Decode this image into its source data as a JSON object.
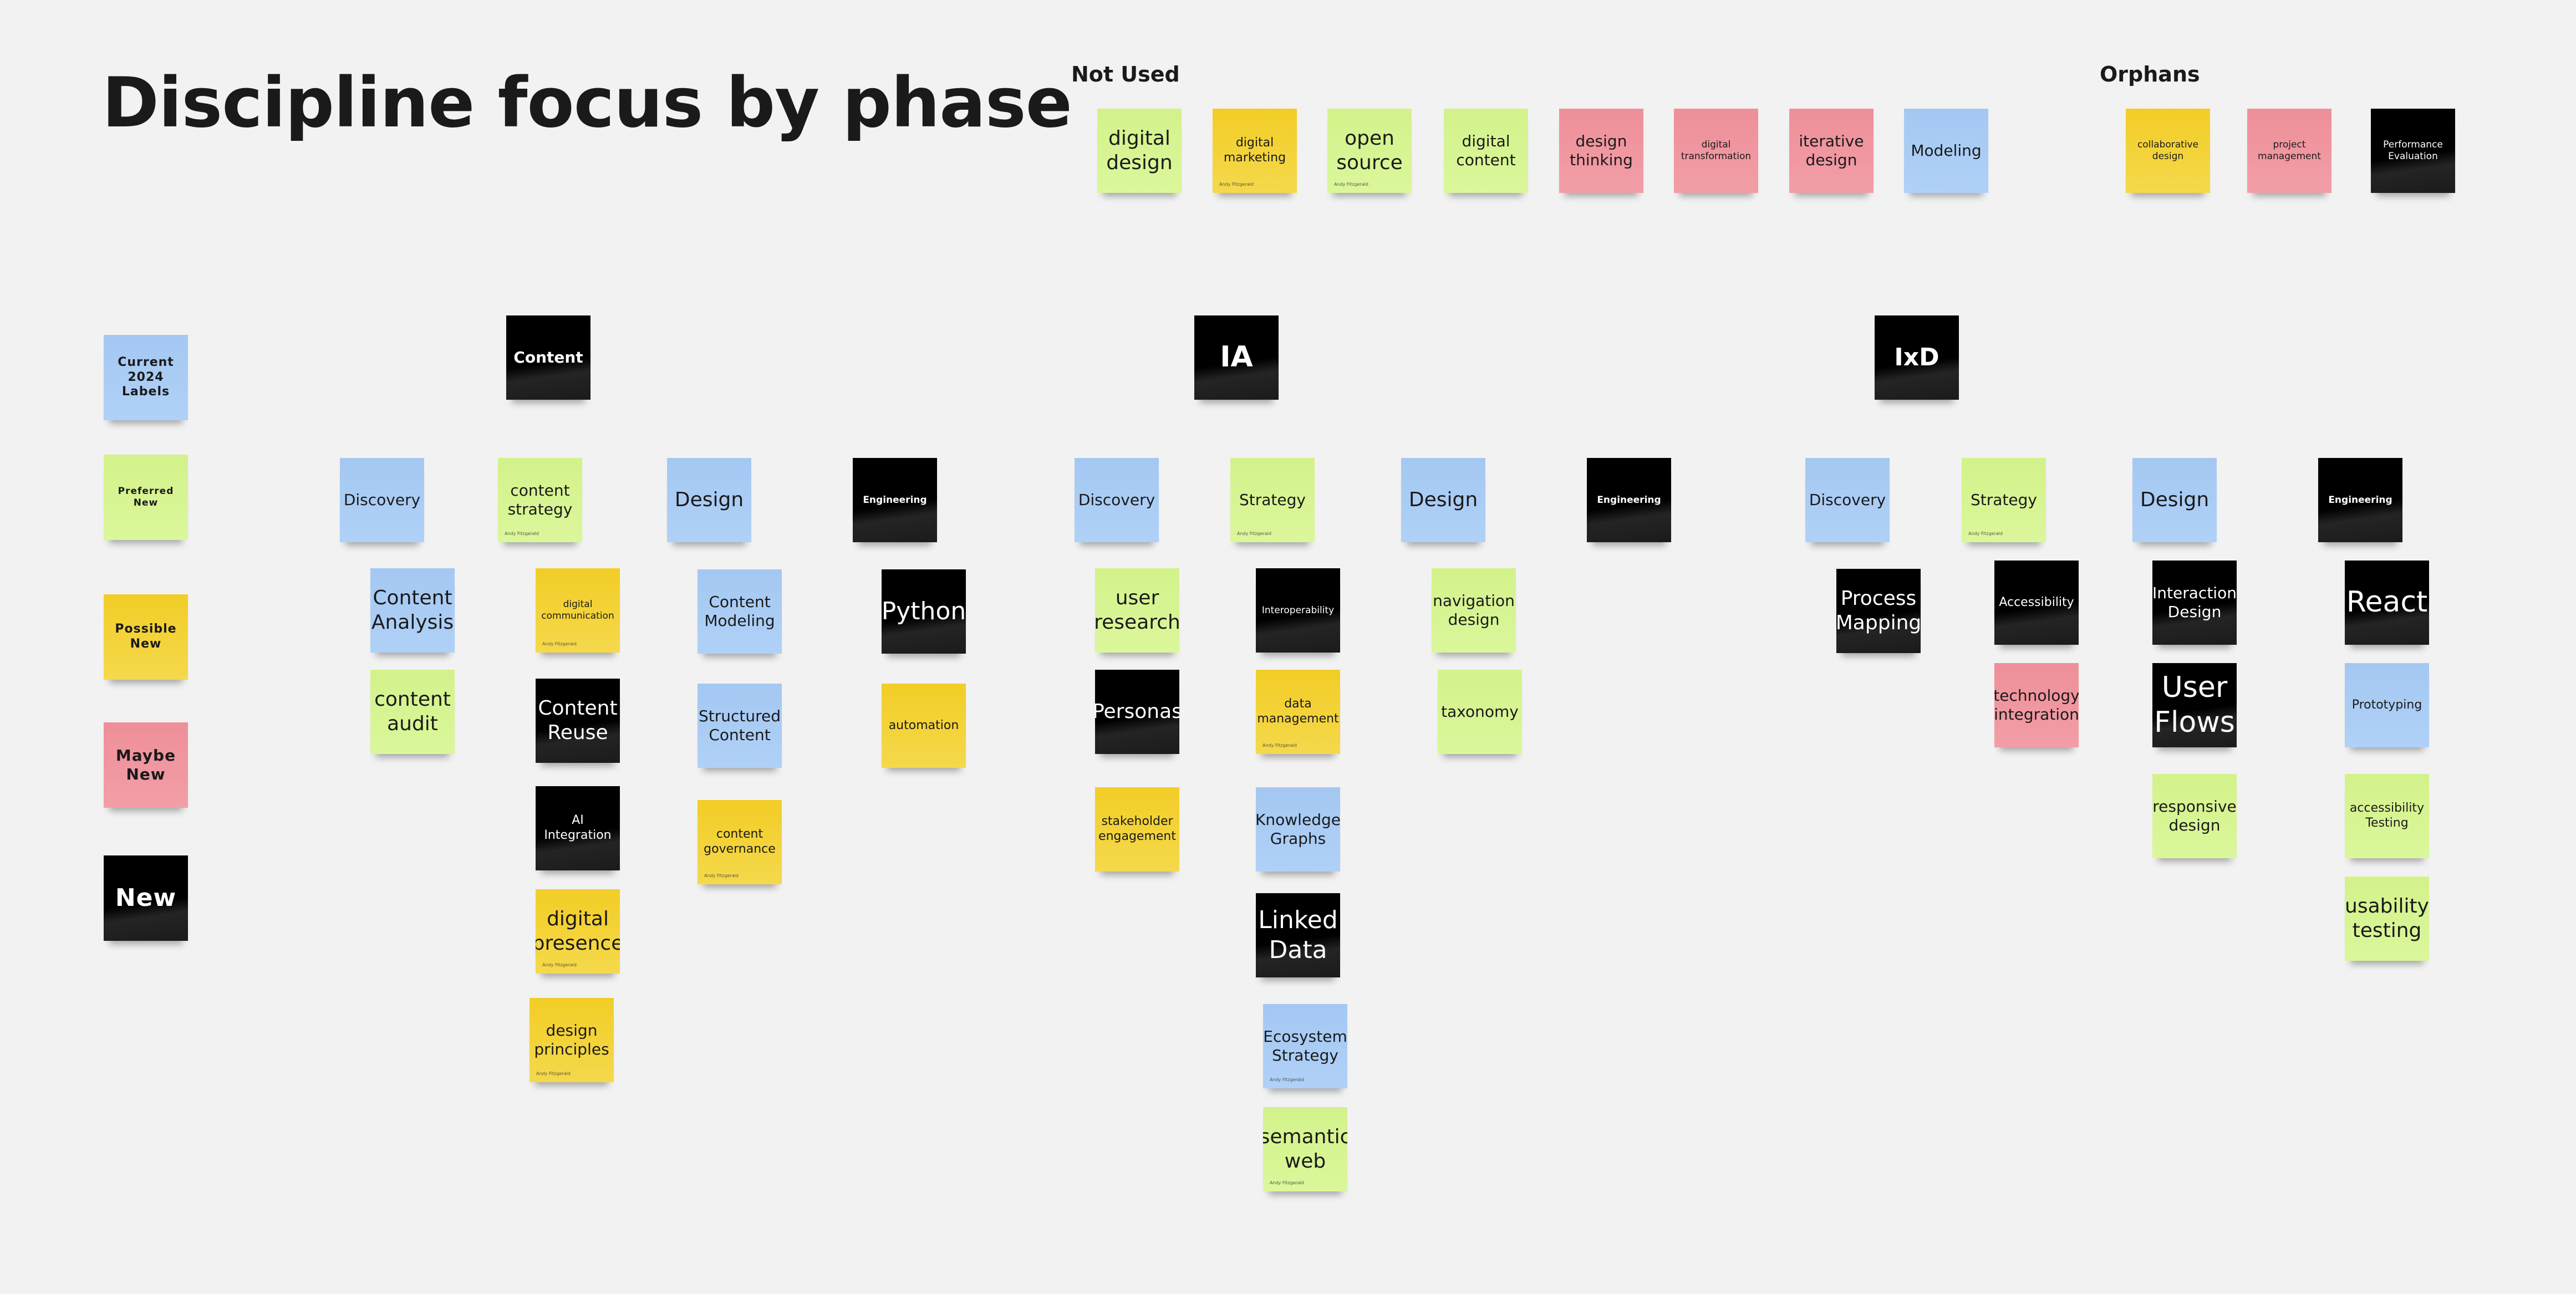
{
  "board": {
    "title": "Discipline focus by phase",
    "colors": {
      "blue": "#a9cdf5",
      "green": "#d6f591",
      "yellow": "#f4d02f",
      "pink": "#f097a0",
      "black": "#000000",
      "background": "#f2f2f2"
    }
  },
  "legend": [
    {
      "label": "Current 2024 Labels",
      "color": "blue"
    },
    {
      "label": "Preferred New",
      "color": "green"
    },
    {
      "label": "Possible New",
      "color": "yellow"
    },
    {
      "label": "Maybe New",
      "color": "pink"
    },
    {
      "label": "New",
      "color": "black"
    }
  ],
  "not_used": {
    "label": "Not Used",
    "notes": [
      {
        "text": "digital design",
        "color": "green"
      },
      {
        "text": "digital marketing",
        "color": "yellow",
        "author": "Andy Fitzgerald"
      },
      {
        "text": "open source",
        "color": "green",
        "author": "Andy Fitzgerald"
      },
      {
        "text": "digital content",
        "color": "green"
      },
      {
        "text": "design thinking",
        "color": "pink"
      },
      {
        "text": "digital transformation",
        "color": "pink"
      },
      {
        "text": "iterative design",
        "color": "pink"
      },
      {
        "text": "Modeling",
        "color": "blue"
      }
    ]
  },
  "orphans": {
    "label": "Orphans",
    "notes": [
      {
        "text": "collaborative design",
        "color": "yellow"
      },
      {
        "text": "project management",
        "color": "pink"
      },
      {
        "text": "Performance Evaluation",
        "color": "black"
      }
    ]
  },
  "disciplines": [
    {
      "name": "Content",
      "phases": [
        {
          "name": "Discovery",
          "color": "blue",
          "notes": [
            {
              "text": "Content Analysis",
              "color": "blue"
            },
            {
              "text": "content audit",
              "color": "green"
            }
          ]
        },
        {
          "name": "content strategy",
          "color": "green",
          "author": "Andy Fitzgerald",
          "notes": [
            {
              "text": "digital communication",
              "color": "yellow",
              "author": "Andy Fitzgerald"
            },
            {
              "text": "Content Reuse",
              "color": "black"
            },
            {
              "text": "AI Integration",
              "color": "black"
            },
            {
              "text": "digital presence",
              "color": "yellow",
              "author": "Andy Fitzgerald"
            },
            {
              "text": "design principles",
              "color": "yellow",
              "author": "Andy Fitzgerald"
            }
          ]
        },
        {
          "name": "Design",
          "color": "blue",
          "notes": [
            {
              "text": "Content Modeling",
              "color": "blue"
            },
            {
              "text": "Structured Content",
              "color": "blue"
            },
            {
              "text": "content governance",
              "color": "yellow",
              "author": "Andy Fitzgerald"
            }
          ]
        },
        {
          "name": "Engineering",
          "color": "black",
          "notes": [
            {
              "text": "Python",
              "color": "black"
            },
            {
              "text": "automation",
              "color": "yellow"
            }
          ]
        }
      ]
    },
    {
      "name": "IA",
      "phases": [
        {
          "name": "Discovery",
          "color": "blue",
          "notes": [
            {
              "text": "user research",
              "color": "green"
            },
            {
              "text": "Personas",
              "color": "black"
            },
            {
              "text": "stakeholder engagement",
              "color": "yellow"
            }
          ]
        },
        {
          "name": "Strategy",
          "color": "green",
          "author": "Andy Fitzgerald",
          "notes": [
            {
              "text": "Interoperability",
              "color": "black"
            },
            {
              "text": "data management",
              "color": "yellow",
              "author": "Andy Fitzgerald"
            },
            {
              "text": "Knowledge Graphs",
              "color": "blue"
            },
            {
              "text": "Linked Data",
              "color": "black"
            },
            {
              "text": "Ecosystem Strategy",
              "color": "blue",
              "author": "Andy Fitzgerald"
            },
            {
              "text": "semantic web",
              "color": "green",
              "author": "Andy Fitzgerald"
            }
          ]
        },
        {
          "name": "Design",
          "color": "blue",
          "notes": [
            {
              "text": "navigation design",
              "color": "green"
            },
            {
              "text": "taxonomy",
              "color": "green"
            }
          ]
        },
        {
          "name": "Engineering",
          "color": "black",
          "notes": []
        }
      ]
    },
    {
      "name": "IxD",
      "phases": [
        {
          "name": "Discovery",
          "color": "blue",
          "notes": [
            {
              "text": "Process Mapping",
              "color": "black"
            }
          ]
        },
        {
          "name": "Strategy",
          "color": "green",
          "author": "Andy Fitzgerald",
          "notes": [
            {
              "text": "Accessibility",
              "color": "black"
            },
            {
              "text": "technology integration",
              "color": "pink"
            }
          ]
        },
        {
          "name": "Design",
          "color": "blue",
          "notes": [
            {
              "text": "Interaction Design",
              "color": "black"
            },
            {
              "text": "User Flows",
              "color": "black"
            },
            {
              "text": "responsive design",
              "color": "green"
            }
          ]
        },
        {
          "name": "Engineering",
          "color": "black",
          "notes": [
            {
              "text": "React",
              "color": "black"
            },
            {
              "text": "Prototyping",
              "color": "blue"
            },
            {
              "text": "accessibility Testing",
              "color": "green"
            },
            {
              "text": "usability testing",
              "color": "green"
            }
          ]
        }
      ]
    }
  ]
}
